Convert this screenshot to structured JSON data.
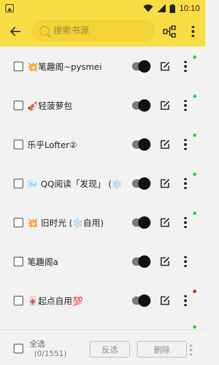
{
  "status_bar": {
    "time": "10:10",
    "icons": [
      "image-icon",
      "wifi-icon",
      "signal-icon",
      "battery-icon"
    ]
  },
  "app_bar": {
    "back_icon": "back-arrow-icon",
    "search_placeholder": "搜索书源",
    "group_icon": "group-tree-icon",
    "more_icon": "more-vert-icon",
    "background_color": "#f9dd45"
  },
  "sources": [
    {
      "name": "💥笔趣阁~pysmei",
      "enabled": true,
      "status_color": "#22d84a"
    },
    {
      "name": "🎻轻菠萝包",
      "enabled": true,
      "status_color": "#22d84a"
    },
    {
      "name": "乐乎Lofter②",
      "enabled": true,
      "status_color": "#22d84a"
    },
    {
      "name": "🌬️ QQ阅读「发现」 (❄️",
      "enabled": true,
      "status_color": "#22d84a"
    },
    {
      "name": "💥 旧时光 (❄️自用)",
      "enabled": true,
      "status_color": "#22d84a"
    },
    {
      "name": "笔趣阁a",
      "enabled": true,
      "status_color": ""
    },
    {
      "name": "🀄起点自用💯",
      "enabled": true,
      "status_color": "#e02020"
    }
  ],
  "bottom_bar": {
    "select_all_label": "全选",
    "count": "(0/1551)",
    "invert_label": "反选",
    "delete_label": "删除"
  }
}
